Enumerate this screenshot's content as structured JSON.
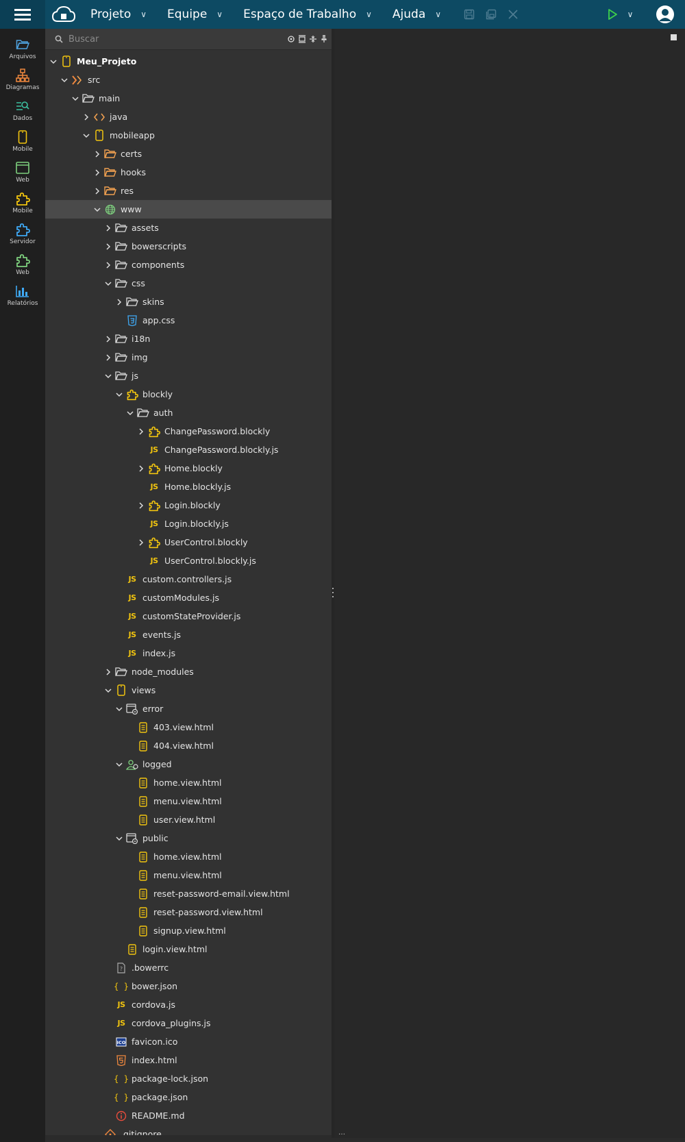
{
  "topbar": {
    "menus": [
      {
        "label": "Projeto"
      },
      {
        "label": "Equipe"
      },
      {
        "label": "Espaço de Trabalho"
      },
      {
        "label": "Ajuda"
      }
    ]
  },
  "search": {
    "placeholder": "Buscar"
  },
  "leftnav": [
    {
      "label": "Arquivos",
      "icon": "folder-icon",
      "color": "#4fa3e0"
    },
    {
      "label": "Diagramas",
      "icon": "diagram-icon",
      "color": "#f0883e"
    },
    {
      "label": "Dados",
      "icon": "data-search-icon",
      "color": "#3cc0a0"
    },
    {
      "label": "Mobile",
      "icon": "mobile-icon",
      "color": "#f1c40f"
    },
    {
      "label": "Web",
      "icon": "web-window-icon",
      "color": "#7ed07e"
    },
    {
      "label": "Mobile",
      "icon": "puzzle-icon",
      "color": "#f1c40f"
    },
    {
      "label": "Servidor",
      "icon": "puzzle-icon",
      "color": "#3fa9f5"
    },
    {
      "label": "Web",
      "icon": "puzzle-icon",
      "color": "#7ed07e"
    },
    {
      "label": "Relatórios",
      "icon": "bar-chart-icon",
      "color": "#3fa9f5"
    }
  ],
  "tree": [
    {
      "label": "Meu_Projeto",
      "depth": 0,
      "toggle": "open",
      "icon": "mobile",
      "bold": true
    },
    {
      "label": "src",
      "depth": 1,
      "toggle": "open",
      "icon": "src"
    },
    {
      "label": "main",
      "depth": 2,
      "toggle": "open",
      "icon": "folder-open"
    },
    {
      "label": "java",
      "depth": 3,
      "toggle": "closed",
      "icon": "code"
    },
    {
      "label": "mobileapp",
      "depth": 3,
      "toggle": "open",
      "icon": "mobile"
    },
    {
      "label": "certs",
      "depth": 4,
      "toggle": "closed",
      "icon": "folder-orange"
    },
    {
      "label": "hooks",
      "depth": 4,
      "toggle": "closed",
      "icon": "folder-orange"
    },
    {
      "label": "res",
      "depth": 4,
      "toggle": "closed",
      "icon": "folder-orange"
    },
    {
      "label": "www",
      "depth": 4,
      "toggle": "open",
      "icon": "globe",
      "selected": true
    },
    {
      "label": "assets",
      "depth": 5,
      "toggle": "closed",
      "icon": "folder"
    },
    {
      "label": "bowerscripts",
      "depth": 5,
      "toggle": "closed",
      "icon": "folder"
    },
    {
      "label": "components",
      "depth": 5,
      "toggle": "closed",
      "icon": "folder"
    },
    {
      "label": "css",
      "depth": 5,
      "toggle": "open",
      "icon": "folder-open"
    },
    {
      "label": "skins",
      "depth": 6,
      "toggle": "closed",
      "icon": "folder"
    },
    {
      "label": "app.css",
      "depth": 6,
      "toggle": "none",
      "icon": "css"
    },
    {
      "label": "i18n",
      "depth": 5,
      "toggle": "closed",
      "icon": "folder"
    },
    {
      "label": "img",
      "depth": 5,
      "toggle": "closed",
      "icon": "folder"
    },
    {
      "label": "js",
      "depth": 5,
      "toggle": "open",
      "icon": "folder-open"
    },
    {
      "label": "blockly",
      "depth": 6,
      "toggle": "open",
      "icon": "puzzle"
    },
    {
      "label": "auth",
      "depth": 7,
      "toggle": "open",
      "icon": "folder-open"
    },
    {
      "label": "ChangePassword.blockly",
      "depth": 8,
      "toggle": "closed",
      "icon": "puzzle"
    },
    {
      "label": "ChangePassword.blockly.js",
      "depth": 8,
      "toggle": "none",
      "icon": "js"
    },
    {
      "label": "Home.blockly",
      "depth": 8,
      "toggle": "closed",
      "icon": "puzzle"
    },
    {
      "label": "Home.blockly.js",
      "depth": 8,
      "toggle": "none",
      "icon": "js"
    },
    {
      "label": "Login.blockly",
      "depth": 8,
      "toggle": "closed",
      "icon": "puzzle"
    },
    {
      "label": "Login.blockly.js",
      "depth": 8,
      "toggle": "none",
      "icon": "js"
    },
    {
      "label": "UserControl.blockly",
      "depth": 8,
      "toggle": "closed",
      "icon": "puzzle"
    },
    {
      "label": "UserControl.blockly.js",
      "depth": 8,
      "toggle": "none",
      "icon": "js"
    },
    {
      "label": "custom.controllers.js",
      "depth": 6,
      "toggle": "none",
      "icon": "js"
    },
    {
      "label": "customModules.js",
      "depth": 6,
      "toggle": "none",
      "icon": "js"
    },
    {
      "label": "customStateProvider.js",
      "depth": 6,
      "toggle": "none",
      "icon": "js"
    },
    {
      "label": "events.js",
      "depth": 6,
      "toggle": "none",
      "icon": "js"
    },
    {
      "label": "index.js",
      "depth": 6,
      "toggle": "none",
      "icon": "js"
    },
    {
      "label": "node_modules",
      "depth": 5,
      "toggle": "closed",
      "icon": "folder"
    },
    {
      "label": "views",
      "depth": 5,
      "toggle": "open",
      "icon": "mobile"
    },
    {
      "label": "error",
      "depth": 6,
      "toggle": "open",
      "icon": "view-folder"
    },
    {
      "label": "403.view.html",
      "depth": 7,
      "toggle": "none",
      "icon": "view"
    },
    {
      "label": "404.view.html",
      "depth": 7,
      "toggle": "none",
      "icon": "view"
    },
    {
      "label": "logged",
      "depth": 6,
      "toggle": "open",
      "icon": "user-group"
    },
    {
      "label": "home.view.html",
      "depth": 7,
      "toggle": "none",
      "icon": "view"
    },
    {
      "label": "menu.view.html",
      "depth": 7,
      "toggle": "none",
      "icon": "view"
    },
    {
      "label": "user.view.html",
      "depth": 7,
      "toggle": "none",
      "icon": "view"
    },
    {
      "label": "public",
      "depth": 6,
      "toggle": "open",
      "icon": "view-folder"
    },
    {
      "label": "home.view.html",
      "depth": 7,
      "toggle": "none",
      "icon": "view"
    },
    {
      "label": "menu.view.html",
      "depth": 7,
      "toggle": "none",
      "icon": "view"
    },
    {
      "label": "reset-password-email.view.html",
      "depth": 7,
      "toggle": "none",
      "icon": "view"
    },
    {
      "label": "reset-password.view.html",
      "depth": 7,
      "toggle": "none",
      "icon": "view"
    },
    {
      "label": "signup.view.html",
      "depth": 7,
      "toggle": "none",
      "icon": "view"
    },
    {
      "label": "login.view.html",
      "depth": 6,
      "toggle": "none",
      "icon": "view"
    },
    {
      "label": ".bowerrc",
      "depth": 5,
      "toggle": "none",
      "icon": "unknown"
    },
    {
      "label": "bower.json",
      "depth": 5,
      "toggle": "none",
      "icon": "json"
    },
    {
      "label": "cordova.js",
      "depth": 5,
      "toggle": "none",
      "icon": "js"
    },
    {
      "label": "cordova_plugins.js",
      "depth": 5,
      "toggle": "none",
      "icon": "js"
    },
    {
      "label": "favicon.ico",
      "depth": 5,
      "toggle": "none",
      "icon": "ico"
    },
    {
      "label": "index.html",
      "depth": 5,
      "toggle": "none",
      "icon": "html5"
    },
    {
      "label": "package-lock.json",
      "depth": 5,
      "toggle": "none",
      "icon": "json"
    },
    {
      "label": "package.json",
      "depth": 5,
      "toggle": "none",
      "icon": "json"
    },
    {
      "label": "README.md",
      "depth": 5,
      "toggle": "none",
      "icon": "info"
    },
    {
      "label": ".gitignore",
      "depth": 4,
      "toggle": "none",
      "icon": "git"
    }
  ]
}
